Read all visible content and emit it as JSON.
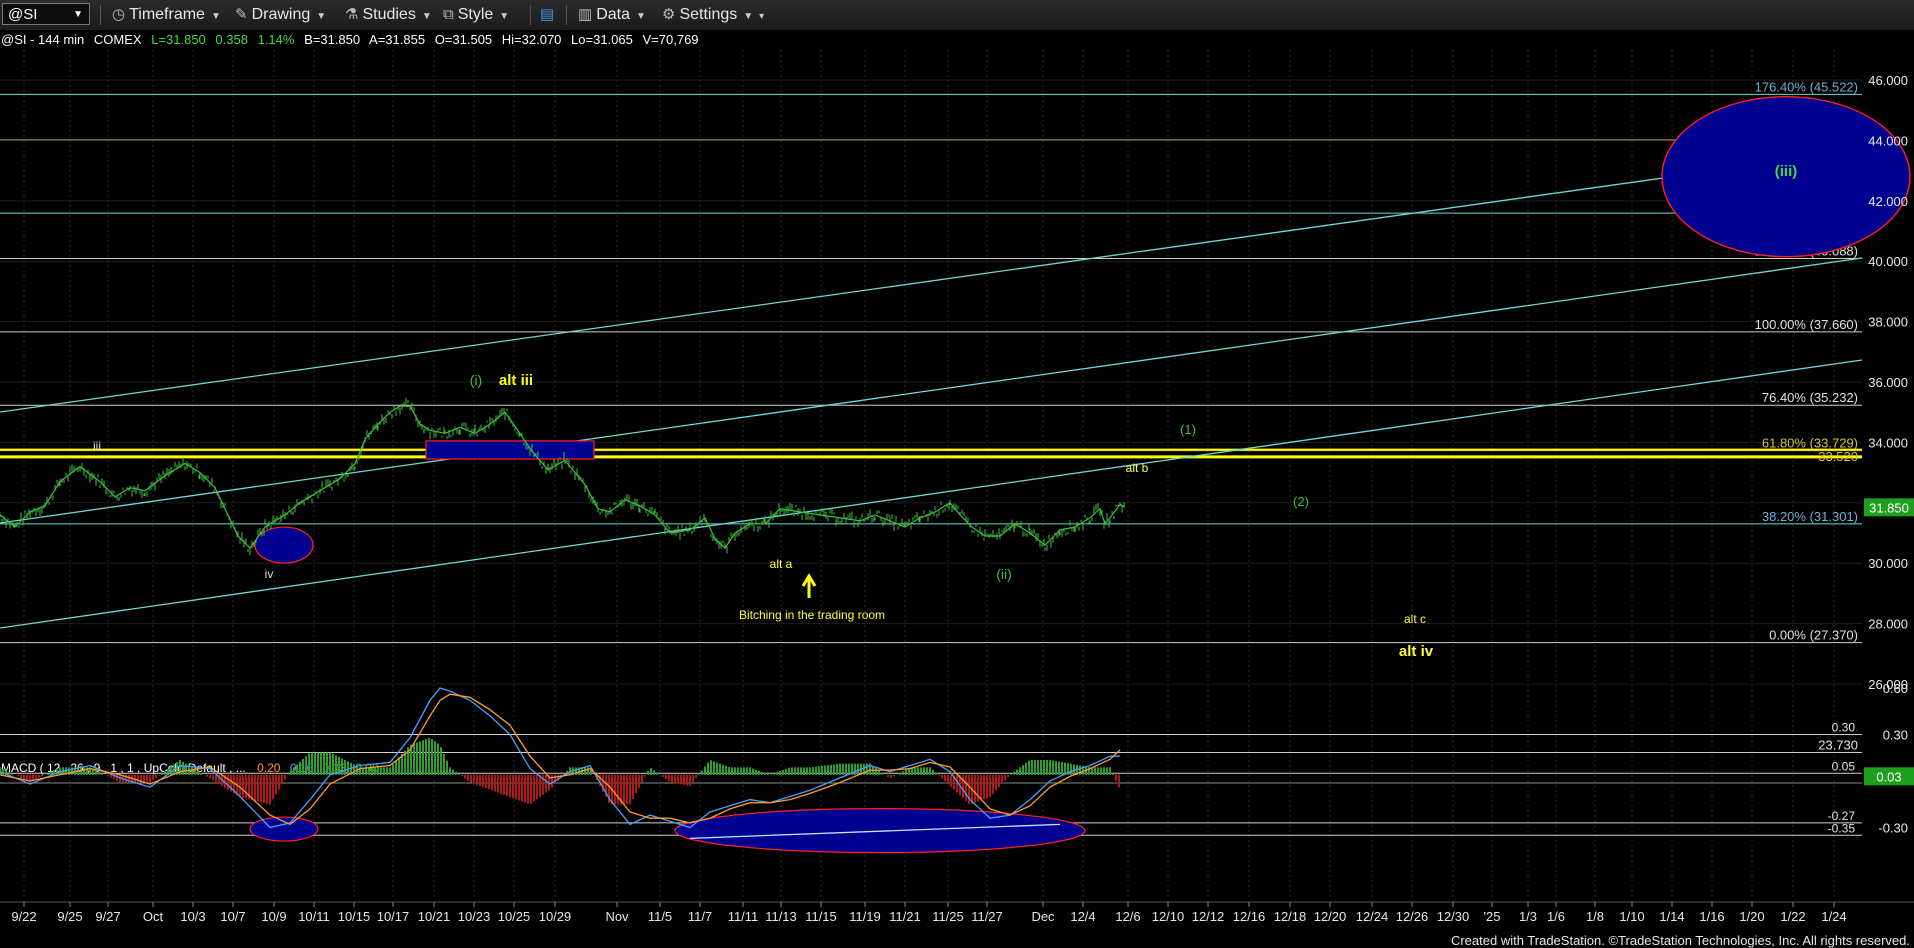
{
  "toolbar": {
    "symbol": "@SI",
    "timeframe": "Timeframe",
    "drawing": "Drawing",
    "studies": "Studies",
    "style": "Style",
    "data": "Data",
    "settings": "Settings"
  },
  "info_line": {
    "symbol": "@SI - 144 min",
    "exchange": "COMEX",
    "last": "L=31.850",
    "change": "0.358",
    "change_pct": "1.14%",
    "bid": "B=31.850",
    "ask": "A=31.855",
    "open": "O=31.505",
    "high": "Hi=32.070",
    "low": "Lo=31.065",
    "volume": "V=70,769"
  },
  "macd_header": {
    "name": "MACD ( 12 , 26 , 9 , 1 , 1 , UpColorDefault , ...",
    "v1": "0.20",
    "v2": "0.16",
    "v3": "0.03",
    "v4": "0.00"
  },
  "colors": {
    "price": "#3fbf3f",
    "fib": "#cfcfcf",
    "channel": "#6fd8d8",
    "accent_yellow": "#ffff00",
    "ellipse_fill": "#000090",
    "ellipse_stroke": "#ff2020",
    "last_price_bg": "#1f9f1f",
    "macd_line": "#4aa0ff",
    "signal_line": "#ff9a30",
    "hist_pos": "#2fa02f",
    "hist_neg": "#b01818"
  },
  "chart_data": [
    {
      "type": "line",
      "title": "@SI - 144 min COMEX",
      "y_range": [
        23.0,
        47.0
      ],
      "y_ticks": [
        "46.000",
        "44.000",
        "42.000",
        "40.000",
        "38.000",
        "36.000",
        "34.000",
        "32.000",
        "30.000",
        "28.000",
        "26.000"
      ],
      "x_ticks": [
        "9/22",
        "9/25",
        "9/27",
        "Oct",
        "10/3",
        "10/7",
        "10/9",
        "10/11",
        "10/15",
        "10/17",
        "10/21",
        "10/23",
        "10/25",
        "10/29",
        "Nov",
        "11/5",
        "11/7",
        "11/11",
        "11/13",
        "11/15",
        "11/19",
        "11/21",
        "11/25",
        "11/27",
        "Dec",
        "12/4",
        "12/6",
        "12/10",
        "12/12",
        "12/16",
        "12/18",
        "12/20",
        "12/24",
        "12/26",
        "12/30",
        "'25",
        "1/3",
        "1/6",
        "1/8",
        "1/10",
        "1/14",
        "1/16",
        "1/20",
        "1/22",
        "1/24"
      ],
      "series": [
        {
          "name": "@SI",
          "points": [
            [
              0,
              31.6
            ],
            [
              15,
              31.2
            ],
            [
              30,
              31.7
            ],
            [
              45,
              31.9
            ],
            [
              60,
              32.7
            ],
            [
              80,
              33.2
            ],
            [
              100,
              32.7
            ],
            [
              115,
              32.2
            ],
            [
              130,
              32.5
            ],
            [
              145,
              32.4
            ],
            [
              165,
              32.9
            ],
            [
              185,
              33.3
            ],
            [
              200,
              33.0
            ],
            [
              215,
              32.5
            ],
            [
              225,
              31.8
            ],
            [
              238,
              30.9
            ],
            [
              250,
              30.5
            ],
            [
              265,
              31.2
            ],
            [
              285,
              31.6
            ],
            [
              300,
              32.0
            ],
            [
              320,
              32.4
            ],
            [
              340,
              32.8
            ],
            [
              355,
              33.3
            ],
            [
              365,
              34.1
            ],
            [
              378,
              34.6
            ],
            [
              390,
              35.0
            ],
            [
              400,
              35.2
            ],
            [
              410,
              35.2
            ],
            [
              420,
              34.6
            ],
            [
              430,
              34.4
            ],
            [
              445,
              34.3
            ],
            [
              460,
              34.5
            ],
            [
              475,
              34.3
            ],
            [
              490,
              34.6
            ],
            [
              505,
              35.0
            ],
            [
              520,
              34.3
            ],
            [
              532,
              33.7
            ],
            [
              548,
              33.1
            ],
            [
              565,
              33.4
            ],
            [
              575,
              33.0
            ],
            [
              585,
              32.6
            ],
            [
              598,
              31.8
            ],
            [
              610,
              31.7
            ],
            [
              625,
              32.1
            ],
            [
              640,
              31.9
            ],
            [
              655,
              31.6
            ],
            [
              670,
              31.0
            ],
            [
              690,
              31.1
            ],
            [
              705,
              31.5
            ],
            [
              715,
              30.8
            ],
            [
              725,
              30.5
            ],
            [
              735,
              31.0
            ],
            [
              750,
              31.3
            ],
            [
              765,
              31.3
            ],
            [
              780,
              31.8
            ],
            [
              800,
              31.7
            ],
            [
              820,
              31.6
            ],
            [
              840,
              31.5
            ],
            [
              860,
              31.4
            ],
            [
              875,
              31.6
            ],
            [
              890,
              31.4
            ],
            [
              905,
              31.2
            ],
            [
              920,
              31.5
            ],
            [
              935,
              31.7
            ],
            [
              950,
              32.0
            ],
            [
              960,
              31.6
            ],
            [
              972,
              31.2
            ],
            [
              985,
              30.9
            ],
            [
              1000,
              30.9
            ],
            [
              1015,
              31.3
            ],
            [
              1030,
              31.0
            ],
            [
              1045,
              30.6
            ],
            [
              1060,
              31.1
            ],
            [
              1075,
              31.2
            ],
            [
              1090,
              31.5
            ],
            [
              1100,
              31.8
            ],
            [
              1105,
              31.3
            ],
            [
              1110,
              31.5
            ],
            [
              1120,
              31.95
            ],
            [
              1125,
              31.85
            ]
          ]
        }
      ],
      "horizontal_levels": [
        {
          "label": "176.40% (45.522)",
          "value": 45.522
        },
        {
          "label": "161.80% (44.019)",
          "value": 44.019
        },
        {
          "label": "138.20% (41.591)",
          "value": 41.591
        },
        {
          "label": "123.60% (40.088)",
          "value": 40.088
        },
        {
          "label": "100.00% (37.660)",
          "value": 37.66
        },
        {
          "label": "76.40% (35.232)",
          "value": 35.232
        },
        {
          "label": "61.80% (33.729)",
          "value": 33.729
        },
        {
          "label": "33.520",
          "value": 33.52
        },
        {
          "label": "38.20% (31.301)",
          "value": 31.301
        },
        {
          "label": "0.00% (27.370)",
          "value": 27.37
        },
        {
          "label": "23.730",
          "value": 23.73
        }
      ],
      "last_price": "31.850",
      "annotations": [
        {
          "text": "(i)"
        },
        {
          "text": "alt iii"
        },
        {
          "text": "iii"
        },
        {
          "text": "iv"
        },
        {
          "text": "alt a"
        },
        {
          "text": "Bitching in the trading room"
        },
        {
          "text": "(ii)"
        },
        {
          "text": "(1)"
        },
        {
          "text": "alt b"
        },
        {
          "text": "(2)"
        },
        {
          "text": "alt c"
        },
        {
          "text": "alt iv"
        },
        {
          "text": "(iii)"
        }
      ]
    },
    {
      "type": "line",
      "title": "MACD ( 12 , 26 , 9 , 1 , 1 , UpColorDefault , ...",
      "y_range": [
        -0.38,
        0.72
      ],
      "y_ticks": [
        "0.60",
        "0.30",
        "-0.30"
      ],
      "horizontal_levels": [
        {
          "label": "0.30",
          "value": 0.3
        },
        {
          "label": "0.05",
          "value": 0.05
        },
        {
          "label": "0.03",
          "value": 0.03
        },
        {
          "label": "-0.27",
          "value": -0.27
        },
        {
          "label": "-0.35",
          "value": -0.35
        }
      ],
      "series": [
        {
          "name": "MACD",
          "points": [
            [
              0,
              0.06
            ],
            [
              30,
              -0.02
            ],
            [
              60,
              0.06
            ],
            [
              90,
              0.1
            ],
            [
              120,
              0.02
            ],
            [
              150,
              -0.04
            ],
            [
              180,
              0.1
            ],
            [
              210,
              0.08
            ],
            [
              240,
              -0.1
            ],
            [
              270,
              -0.3
            ],
            [
              290,
              -0.27
            ],
            [
              310,
              -0.12
            ],
            [
              330,
              0.04
            ],
            [
              360,
              0.1
            ],
            [
              390,
              0.12
            ],
            [
              410,
              0.28
            ],
            [
              430,
              0.52
            ],
            [
              440,
              0.6
            ],
            [
              450,
              0.58
            ],
            [
              470,
              0.52
            ],
            [
              490,
              0.42
            ],
            [
              510,
              0.3
            ],
            [
              530,
              0.08
            ],
            [
              550,
              -0.02
            ],
            [
              570,
              0.06
            ],
            [
              590,
              0.1
            ],
            [
              610,
              -0.12
            ],
            [
              630,
              -0.28
            ],
            [
              650,
              -0.22
            ],
            [
              670,
              -0.26
            ],
            [
              690,
              -0.3
            ],
            [
              710,
              -0.2
            ],
            [
              730,
              -0.16
            ],
            [
              750,
              -0.12
            ],
            [
              770,
              -0.14
            ],
            [
              790,
              -0.1
            ],
            [
              810,
              -0.06
            ],
            [
              840,
              0.02
            ],
            [
              870,
              0.1
            ],
            [
              890,
              0.06
            ],
            [
              910,
              0.1
            ],
            [
              930,
              0.14
            ],
            [
              950,
              0.06
            ],
            [
              970,
              -0.12
            ],
            [
              990,
              -0.24
            ],
            [
              1010,
              -0.22
            ],
            [
              1030,
              -0.12
            ],
            [
              1050,
              0.0
            ],
            [
              1070,
              0.06
            ],
            [
              1090,
              0.1
            ],
            [
              1110,
              0.16
            ],
            [
              1120,
              0.16
            ]
          ]
        },
        {
          "name": "Signal",
          "points": [
            [
              0,
              0.04
            ],
            [
              30,
              0.0
            ],
            [
              60,
              0.04
            ],
            [
              90,
              0.08
            ],
            [
              120,
              0.04
            ],
            [
              150,
              -0.02
            ],
            [
              180,
              0.06
            ],
            [
              210,
              0.09
            ],
            [
              240,
              -0.04
            ],
            [
              270,
              -0.22
            ],
            [
              290,
              -0.28
            ],
            [
              310,
              -0.18
            ],
            [
              330,
              -0.02
            ],
            [
              360,
              0.08
            ],
            [
              390,
              0.1
            ],
            [
              410,
              0.2
            ],
            [
              430,
              0.42
            ],
            [
              440,
              0.52
            ],
            [
              450,
              0.56
            ],
            [
              470,
              0.54
            ],
            [
              490,
              0.46
            ],
            [
              510,
              0.36
            ],
            [
              530,
              0.16
            ],
            [
              550,
              0.02
            ],
            [
              570,
              0.04
            ],
            [
              590,
              0.08
            ],
            [
              610,
              -0.04
            ],
            [
              630,
              -0.2
            ],
            [
              650,
              -0.24
            ],
            [
              670,
              -0.24
            ],
            [
              690,
              -0.27
            ],
            [
              710,
              -0.24
            ],
            [
              730,
              -0.18
            ],
            [
              750,
              -0.14
            ],
            [
              770,
              -0.14
            ],
            [
              790,
              -0.12
            ],
            [
              810,
              -0.08
            ],
            [
              840,
              -0.01
            ],
            [
              870,
              0.07
            ],
            [
              890,
              0.07
            ],
            [
              910,
              0.08
            ],
            [
              930,
              0.12
            ],
            [
              950,
              0.09
            ],
            [
              970,
              -0.04
            ],
            [
              990,
              -0.18
            ],
            [
              1010,
              -0.22
            ],
            [
              1030,
              -0.16
            ],
            [
              1050,
              -0.04
            ],
            [
              1070,
              0.03
            ],
            [
              1090,
              0.08
            ],
            [
              1110,
              0.14
            ],
            [
              1120,
              0.2
            ]
          ]
        }
      ]
    }
  ],
  "footer": {
    "text": "Created with TradeStation. ©TradeStation Technologies, Inc. All rights reserved."
  }
}
